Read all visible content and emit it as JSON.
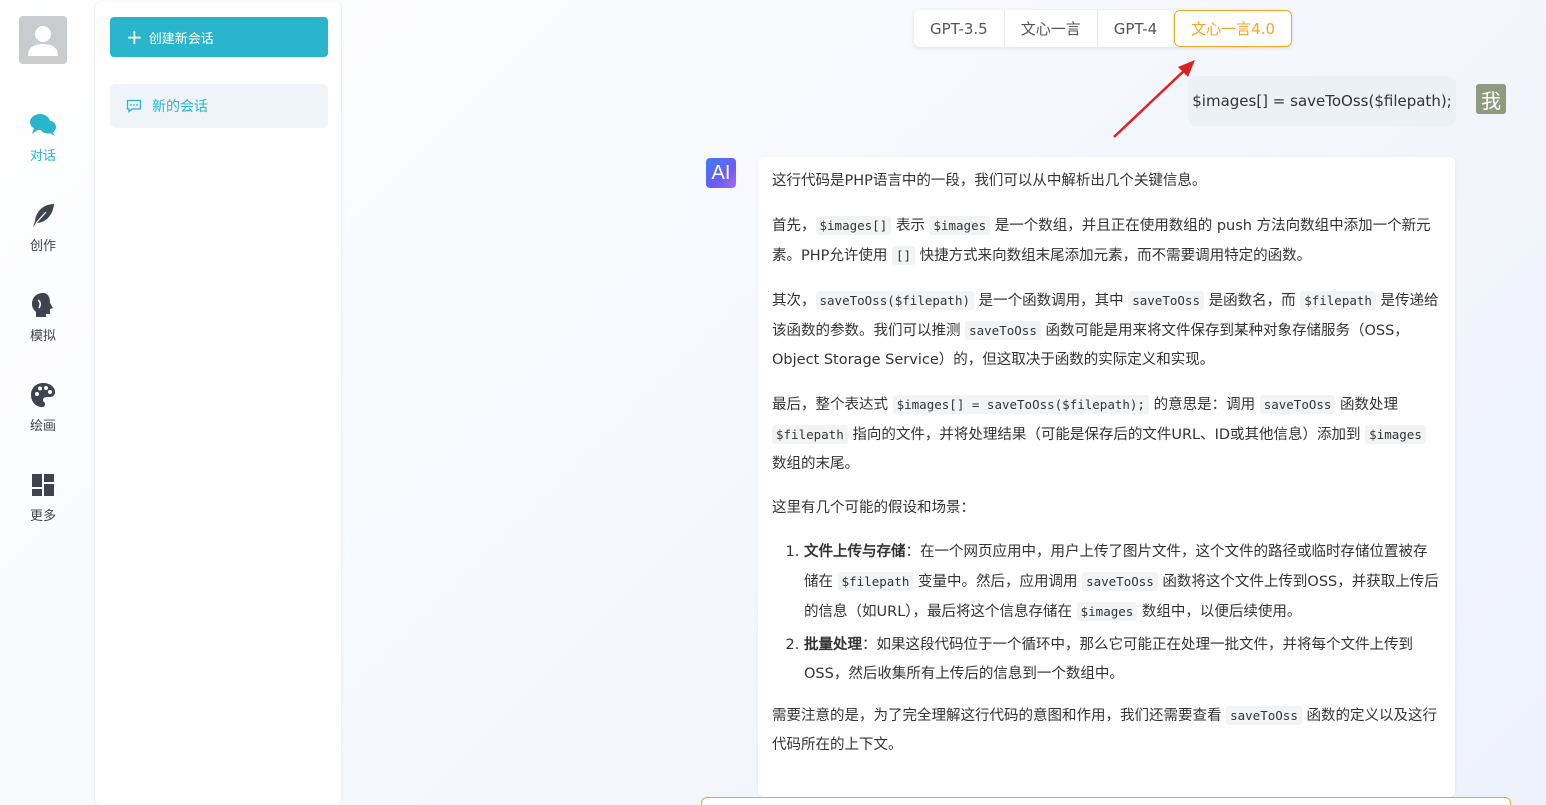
{
  "nav": {
    "items": [
      {
        "label": "对话",
        "icon": "chat-bubbles-icon",
        "active": true
      },
      {
        "label": "创作",
        "icon": "feather-icon",
        "active": false
      },
      {
        "label": "模拟",
        "icon": "head-profile-icon",
        "active": false
      },
      {
        "label": "绘画",
        "icon": "palette-icon",
        "active": false
      },
      {
        "label": "更多",
        "icon": "grid-icon",
        "active": false
      }
    ]
  },
  "sessions": {
    "new_button_label": "创建新会话",
    "items": [
      {
        "label": "新的会话"
      }
    ]
  },
  "models": {
    "tabs": [
      "GPT-3.5",
      "文心一言",
      "GPT-4",
      "文心一言4.0"
    ],
    "active_index": 3
  },
  "chat": {
    "user_avatar_text": "我",
    "user_message": "$images[] = saveToOss($filepath);",
    "ai_avatar_text": "AI",
    "ai": {
      "p1": "这行代码是PHP语言中的一段，我们可以从中解析出几个关键信息。",
      "p2": {
        "t1": "首先，",
        "c1": "$images[]",
        "t2": " 表示 ",
        "c2": "$images",
        "t3": " 是一个数组，并且正在使用数组的 push 方法向数组中添加一个新元素。PHP允许使用 ",
        "c3": "[]",
        "t4": " 快捷方式来向数组末尾添加元素，而不需要调用特定的函数。"
      },
      "p3": {
        "t1": "其次，",
        "c1": "saveToOss($filepath)",
        "t2": " 是一个函数调用，其中 ",
        "c2": "saveToOss",
        "t3": " 是函数名，而 ",
        "c3": "$filepath",
        "t4": " 是传递给该函数的参数。我们可以推测 ",
        "c4": "saveToOss",
        "t5": " 函数可能是用来将文件保存到某种对象存储服务（OSS，Object Storage Service）的，但这取决于函数的实际定义和实现。"
      },
      "p4": {
        "t1": "最后，整个表达式 ",
        "c1": "$images[] = saveToOss($filepath);",
        "t2": " 的意思是：调用 ",
        "c2": "saveToOss",
        "t3": " 函数处理 ",
        "c3": "$filepath",
        "t4": " 指向的文件，并将处理结果（可能是保存后的文件URL、ID或其他信息）添加到 ",
        "c4": "$images",
        "t5": " 数组的末尾。"
      },
      "p5": "这里有几个可能的假设和场景：",
      "list": [
        {
          "bold": "文件上传与存储",
          "t1": "：在一个网页应用中，用户上传了图片文件，这个文件的路径或临时存储位置被存储在 ",
          "c1": "$filepath",
          "t2": " 变量中。然后，应用调用 ",
          "c2": "saveToOss",
          "t3": " 函数将这个文件上传到OSS，并获取上传后的信息（如URL），最后将这个信息存储在 ",
          "c3": "$images",
          "t4": " 数组中，以便后续使用。"
        },
        {
          "bold": "批量处理",
          "t1": "：如果这段代码位于一个循环中，那么它可能正在处理一批文件，并将每个文件上传到OSS，然后收集所有上传后的信息到一个数组中。"
        }
      ],
      "p6": {
        "t1": "需要注意的是，为了完全理解这行代码的意图和作用，我们还需要查看 ",
        "c1": "saveToOss",
        "t2": " 函数的定义以及这行代码所在的上下文。"
      }
    }
  },
  "colors": {
    "accent": "#29b6cc",
    "active_model": "#f5a623",
    "arrow": "#e02020"
  }
}
